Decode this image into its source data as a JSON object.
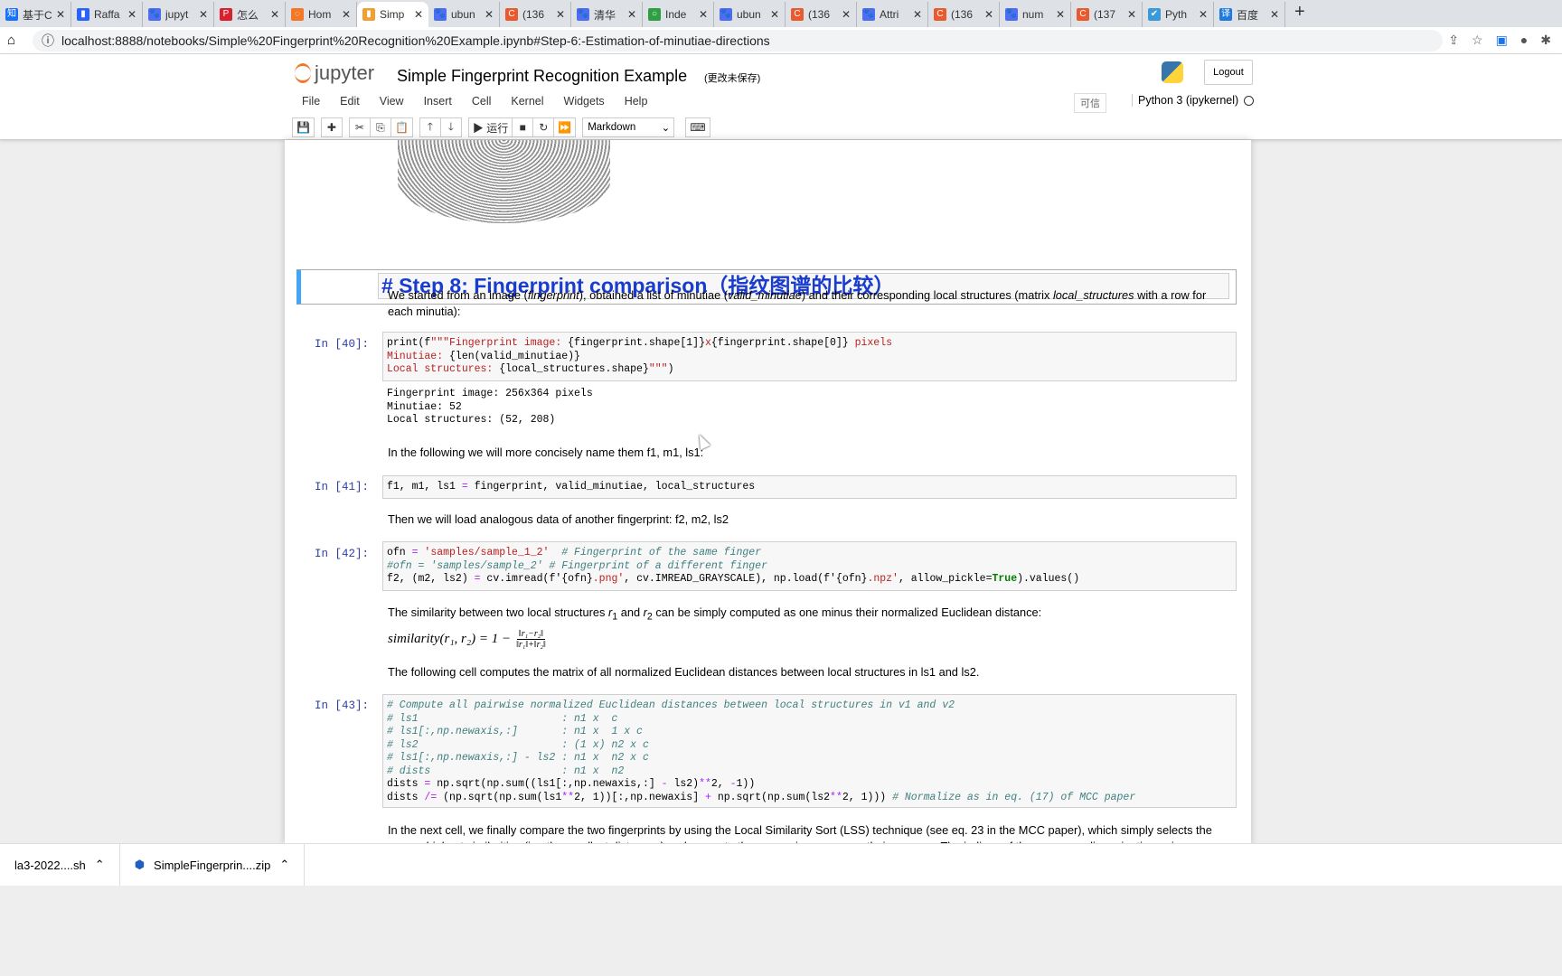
{
  "tabs": [
    {
      "label": "基于C",
      "c": "#1772f6",
      "i": "知"
    },
    {
      "label": "Raffa",
      "c": "#2962ff",
      "i": "▮"
    },
    {
      "label": "jupyt",
      "c": "#4e6ef2",
      "i": "🐾"
    },
    {
      "label": "怎么",
      "c": "#d9212d",
      "i": "P"
    },
    {
      "label": "Hom",
      "c": "#f37726",
      "i": "◌"
    },
    {
      "label": "Simp",
      "c": "#f0a030",
      "i": "▮",
      "active": true
    },
    {
      "label": "ubun",
      "c": "#4e6ef2",
      "i": "🐾"
    },
    {
      "label": "(136",
      "c": "#e95a2f",
      "i": "C"
    },
    {
      "label": "清华",
      "c": "#4e6ef2",
      "i": "🐾"
    },
    {
      "label": "Inde",
      "c": "#2ea043",
      "i": "○"
    },
    {
      "label": "ubun",
      "c": "#4e6ef2",
      "i": "🐾"
    },
    {
      "label": "(136",
      "c": "#e95a2f",
      "i": "C"
    },
    {
      "label": "Attri",
      "c": "#4e6ef2",
      "i": "🐾"
    },
    {
      "label": "(136",
      "c": "#e95a2f",
      "i": "C"
    },
    {
      "label": "num",
      "c": "#4e6ef2",
      "i": "🐾"
    },
    {
      "label": "(137",
      "c": "#e95a2f",
      "i": "C"
    },
    {
      "label": "Pyth",
      "c": "#3a9ad9",
      "i": "✔"
    },
    {
      "label": "百度",
      "c": "#1f7ae0",
      "i": "译"
    }
  ],
  "url": "localhost:8888/notebooks/Simple%20Fingerprint%20Recognition%20Example.ipynb#Step-6:-Estimation-of-minutiae-directions",
  "header": {
    "logo": "jupyter",
    "title": "Simple Fingerprint Recognition Example",
    "saved": "(更改未保存)",
    "logout": "Logout"
  },
  "menu": [
    "File",
    "Edit",
    "View",
    "Insert",
    "Cell",
    "Kernel",
    "Widgets",
    "Help"
  ],
  "trusted": "可信",
  "kernel": "Python 3 (ipykernel)",
  "toolbar": {
    "run": "▶ 运行",
    "celltype": "Markdown"
  },
  "heading": "# Step 8: Fingerprint comparison（指纹图谱的比较）",
  "md1": "We started from an image (<i>fingerprint</i>), obtained a list of minutiae (<i>valid_minutiae</i>) and their corresponding local structures (matrix <i>local_structures</i> with a row for each minutia):",
  "cells": [
    {
      "prompt": "In [40]:",
      "lines": [
        [
          [
            "n",
            "print(f"
          ],
          [
            "s",
            "\"\"\"Fingerprint image: "
          ],
          [
            "n",
            "{fingerprint.shape[1]}"
          ],
          [
            "s",
            "x"
          ],
          [
            "n",
            "{fingerprint.shape[0]}"
          ],
          [
            "s",
            " pixels"
          ]
        ],
        [
          [
            "s",
            "Minutiae: "
          ],
          [
            "n",
            "{len(valid_minutiae)}"
          ]
        ],
        [
          [
            "s",
            "Local structures: "
          ],
          [
            "n",
            "{local_structures.shape}"
          ],
          [
            "s",
            "\"\"\""
          ],
          [
            "n",
            ")"
          ]
        ]
      ]
    },
    {
      "prompt": "In [41]:",
      "lines": [
        [
          [
            "n",
            "f1, m1, ls1 "
          ],
          [
            "o",
            "="
          ],
          [
            "n",
            " fingerprint, valid_minutiae, local_structures"
          ]
        ]
      ]
    },
    {
      "prompt": "In [42]:",
      "lines": [
        [
          [
            "n",
            "ofn "
          ],
          [
            "o",
            "="
          ],
          [
            "s",
            " 'samples/sample_1_2'"
          ],
          [
            "c",
            "  # Fingerprint of the same finger"
          ]
        ],
        [
          [
            "c",
            "#ofn = 'samples/sample_2' # Fingerprint of a different finger"
          ]
        ],
        [
          [
            "n",
            "f2, (m2, ls2) "
          ],
          [
            "o",
            "="
          ],
          [
            "n",
            " cv.imread(f'{ofn}"
          ],
          [
            "s",
            ".png'"
          ],
          [
            "n",
            ", cv.IMREAD_GRAYSCALE), np.load(f'{ofn}"
          ],
          [
            "s",
            ".npz'"
          ],
          [
            "n",
            ", allow_pickle="
          ],
          [
            "k",
            "True"
          ],
          [
            "n",
            ").values()"
          ]
        ]
      ]
    },
    {
      "prompt": "In [43]:",
      "lines": [
        [
          [
            "c",
            "# Compute all pairwise normalized Euclidean distances between local structures in v1 and v2"
          ]
        ],
        [
          [
            "c",
            "# ls1                       : n1 x  c"
          ]
        ],
        [
          [
            "c",
            "# ls1[:,np.newaxis,:]       : n1 x  1 x c"
          ]
        ],
        [
          [
            "c",
            "# ls2                       : (1 x) n2 x c"
          ]
        ],
        [
          [
            "c",
            "# ls1[:,np.newaxis,:] - ls2 : n1 x  n2 x c"
          ]
        ],
        [
          [
            "c",
            "# dists                     : n1 x  n2"
          ]
        ],
        [
          [
            "n",
            "dists "
          ],
          [
            "o",
            "="
          ],
          [
            "n",
            " np.sqrt(np.sum((ls1[:,np.newaxis,:] "
          ],
          [
            "o",
            "-"
          ],
          [
            "n",
            " ls2)"
          ],
          [
            "o",
            "**"
          ],
          [
            "n",
            "2, "
          ],
          [
            "o",
            "-"
          ],
          [
            "n",
            "1))"
          ]
        ],
        [
          [
            "n",
            "dists "
          ],
          [
            "o",
            "/="
          ],
          [
            "n",
            " (np.sqrt(np.sum(ls1"
          ],
          [
            "o",
            "**"
          ],
          [
            "n",
            "2, 1))[:,np.newaxis] "
          ],
          [
            "o",
            "+"
          ],
          [
            "n",
            " np.sqrt(np.sum(ls2"
          ],
          [
            "o",
            "**"
          ],
          [
            "n",
            "2, 1))) "
          ],
          [
            "c",
            "# Normalize as in eq. (17) of MCC paper"
          ]
        ]
      ]
    }
  ],
  "output40": "Fingerprint image: 256x364 pixels\nMinutiae: 52\nLocal structures: (52, 208)",
  "md2": "In the following we will more concisely name them f1, m1, ls1:",
  "md3": "Then we will load analogous data of another fingerprint: f2, m2, ls2",
  "md4": "The similarity between two local structures <i>r</i><sub>1</sub> and <i>r</i><sub>2</sub> can be simply computed as one minus their normalized Euclidean distance:",
  "math": {
    "lhs": "similarity(r₁, r₂) = 1 −",
    "num": "‖r₁−r₂‖",
    "den": "‖r₁‖+‖r₂‖"
  },
  "md5": "The following cell computes the matrix of all normalized Euclidean distances between local structures in ls1 and ls2.",
  "md6": "In the next cell, we finally compare the two fingerprints by using the Local Similarity Sort (LSS) technique (see eq. 23 in the MCC paper), which simply selects the num_p highest similarities (i.e. the smallest distances) and compute the comparison score as their average. The indices of the corresponding minutiae pairs",
  "downloads": [
    "la3-2022....sh",
    "SimpleFingerprin....zip"
  ]
}
